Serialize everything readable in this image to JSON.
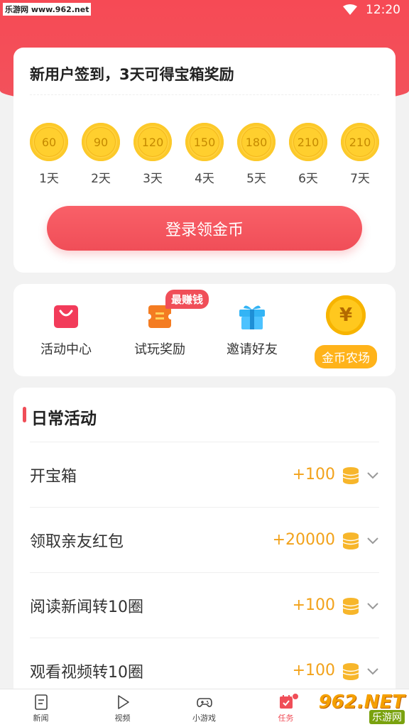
{
  "status_bar": {
    "watermark": "乐游网 www.962.net",
    "time": "12:20"
  },
  "signin": {
    "title": "新用户签到，3天可得宝箱奖励",
    "days": [
      {
        "coins": "60",
        "label": "1天"
      },
      {
        "coins": "90",
        "label": "2天"
      },
      {
        "coins": "120",
        "label": "3天"
      },
      {
        "coins": "150",
        "label": "4天"
      },
      {
        "coins": "180",
        "label": "5天"
      },
      {
        "coins": "210",
        "label": "6天"
      },
      {
        "coins": "210",
        "label": "7天"
      }
    ],
    "button_label": "登录领金币"
  },
  "shortcuts": {
    "activity_center": "活动中心",
    "trial_reward": "试玩奖励",
    "trial_badge": "最赚钱",
    "invite_friends": "邀请好友",
    "gold_farm": "金币农场",
    "farm_coin_symbol": "¥"
  },
  "daily": {
    "title": "日常活动",
    "tasks": [
      {
        "name": "开宝箱",
        "reward": "+100"
      },
      {
        "name": "领取亲友红包",
        "reward": "+20000"
      },
      {
        "name": "阅读新闻转10圈",
        "reward": "+100"
      },
      {
        "name": "观看视频转10圈",
        "reward": "+100"
      }
    ]
  },
  "nav": {
    "items": [
      {
        "label": "新闻",
        "icon": "news-icon"
      },
      {
        "label": "视频",
        "icon": "video-icon"
      },
      {
        "label": "小游戏",
        "icon": "gamepad-icon"
      },
      {
        "label": "任务",
        "icon": "task-icon"
      }
    ]
  },
  "watermark_br": {
    "num": "962.NET",
    "text": "乐游网"
  },
  "colors": {
    "primary": "#f04e58",
    "gold": "#ffcf2e",
    "reward": "#f2a21a"
  }
}
